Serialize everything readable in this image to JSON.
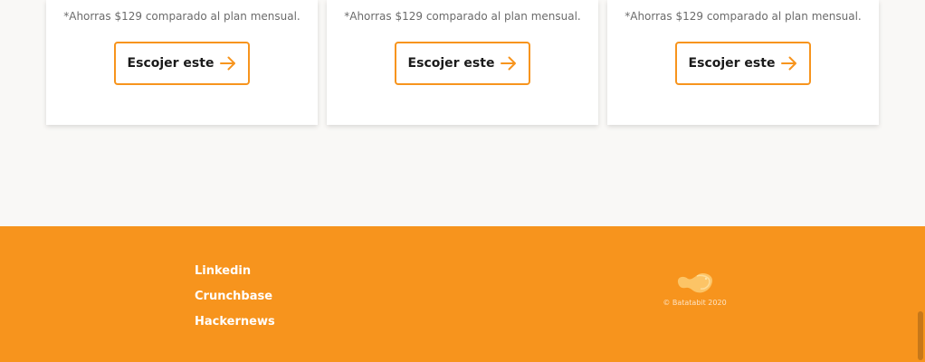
{
  "plans": [
    {
      "savings_note": "*Ahorras $129 comparado al plan mensual.",
      "button_label": "Escojer este"
    },
    {
      "savings_note": "*Ahorras $129 comparado al plan mensual.",
      "button_label": "Escojer este"
    },
    {
      "savings_note": "*Ahorras $129 comparado al plan mensual.",
      "button_label": "Escojer este"
    }
  ],
  "footer": {
    "links": [
      "Linkedin",
      "Crunchbase",
      "Hackernews"
    ],
    "copyright": "© Batatabit 2020",
    "logo_icon": "batatabit-logo-icon"
  },
  "colors": {
    "accent": "#f7941d",
    "page_background": "#f9f8f6",
    "card_background": "#ffffff",
    "button_text": "#1a1a1a"
  },
  "icons": {
    "button_arrow": "arrow-right-icon"
  }
}
